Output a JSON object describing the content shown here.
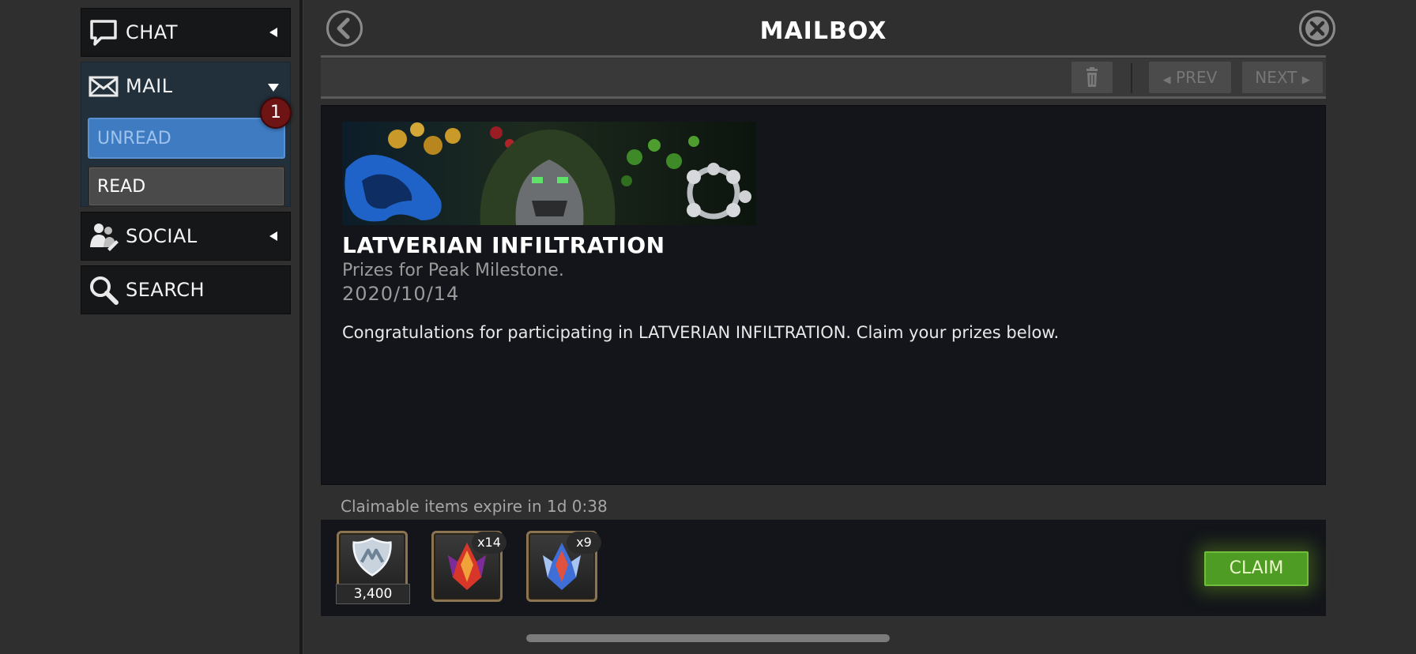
{
  "sidebar": {
    "chat": {
      "label": "CHAT",
      "icon": "speech-bubble-icon"
    },
    "mail": {
      "label": "MAIL",
      "icon": "envelope-icon",
      "unread_label": "UNREAD",
      "unread_count": "1",
      "read_label": "READ"
    },
    "social": {
      "label": "SOCIAL",
      "icon": "people-icon"
    },
    "search": {
      "label": "SEARCH",
      "icon": "magnifier-icon"
    }
  },
  "header": {
    "title": "MAILBOX"
  },
  "toolbar": {
    "prev_label": "PREV",
    "next_label": "NEXT"
  },
  "message": {
    "title": "LATVERIAN INFILTRATION",
    "subtitle": "Prizes for Peak Milestone.",
    "date": "2020/10/14",
    "body": "Congratulations for participating in LATVERIAN INFILTRATION. Claim your prizes below."
  },
  "rewards": {
    "expire_text": "Claimable items expire in 1d 0:38",
    "items": [
      {
        "icon": "shield-badge-icon",
        "count": "3,400"
      },
      {
        "icon": "red-crystal-icon",
        "multiplier": "x14"
      },
      {
        "icon": "blue-crystal-icon",
        "multiplier": "x9"
      }
    ],
    "claim_label": "CLAIM"
  },
  "colors": {
    "accent_blue": "#3f7bc1",
    "claim_green": "#4f9c25",
    "badge_red": "#6e1414",
    "item_border_gold": "#8a7451"
  }
}
